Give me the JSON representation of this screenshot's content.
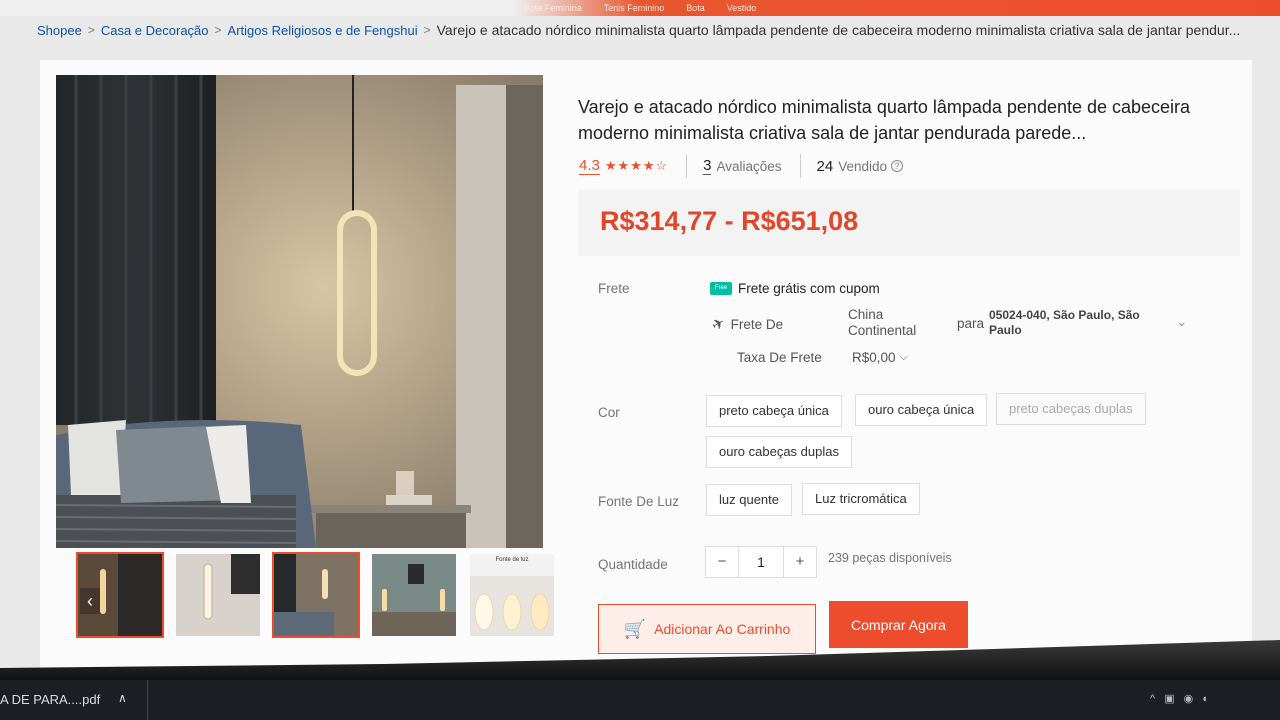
{
  "top_nav": {
    "links": [
      "Bota Feminina",
      "Tenis Feminino",
      "Bota",
      "Vestido"
    ]
  },
  "breadcrumb": {
    "items": [
      "Shopee",
      "Casa e Decoração",
      "Artigos Religiosos e de Fengshui"
    ],
    "current": "Varejo e atacado nórdico minimalista quarto lâmpada pendente de cabeceira moderno minimalista criativa sala de jantar pendur..."
  },
  "product": {
    "title": "Varejo e atacado nórdico minimalista quarto lâmpada pendente de cabeceira moderno minimalista criativa sala de jantar pendurada parede...",
    "rating": "4.3",
    "rating_value": 4.3,
    "reviews_count": "3",
    "reviews_label": "Avaliações",
    "sold_count": "24",
    "sold_label": "Vendido",
    "price": "R$314,77 - R$651,08"
  },
  "shipping": {
    "label": "Frete",
    "free_badge": "Free",
    "free_text": "Frete grátis com cupom",
    "from_label": "Frete De",
    "from_value": "China Continental",
    "to_label": "para",
    "to_value": "05024-040, São Paulo, São Paulo",
    "fee_label": "Taxa De Frete",
    "fee_value": "R$0,00"
  },
  "color": {
    "label": "Cor",
    "options": [
      "preto cabeça única",
      "ouro cabeça única",
      "preto cabeças duplas",
      "ouro cabeças duplas"
    ]
  },
  "light": {
    "label": "Fonte De Luz",
    "options": [
      "luz quente",
      "Luz tricromática"
    ]
  },
  "quantity": {
    "label": "Quantidade",
    "value": "1",
    "minus": "−",
    "plus": "+",
    "stock": "239 peças disponíveis"
  },
  "actions": {
    "add_to_cart": "Adicionar Ao Carrinho",
    "buy_now": "Comprar Agora"
  },
  "gallery": {
    "thumb5_caption": "Fonte de luz"
  },
  "taskbar": {
    "file": "A DE PARA....pdf"
  },
  "colors": {
    "accent": "#ee4d2d",
    "price": "#e2462a",
    "link": "#0d54a8"
  },
  "icons": [
    "chevron-right-icon",
    "star-icon",
    "help-icon",
    "truck-icon",
    "plane-icon",
    "chevron-down-icon",
    "cart-icon"
  ]
}
